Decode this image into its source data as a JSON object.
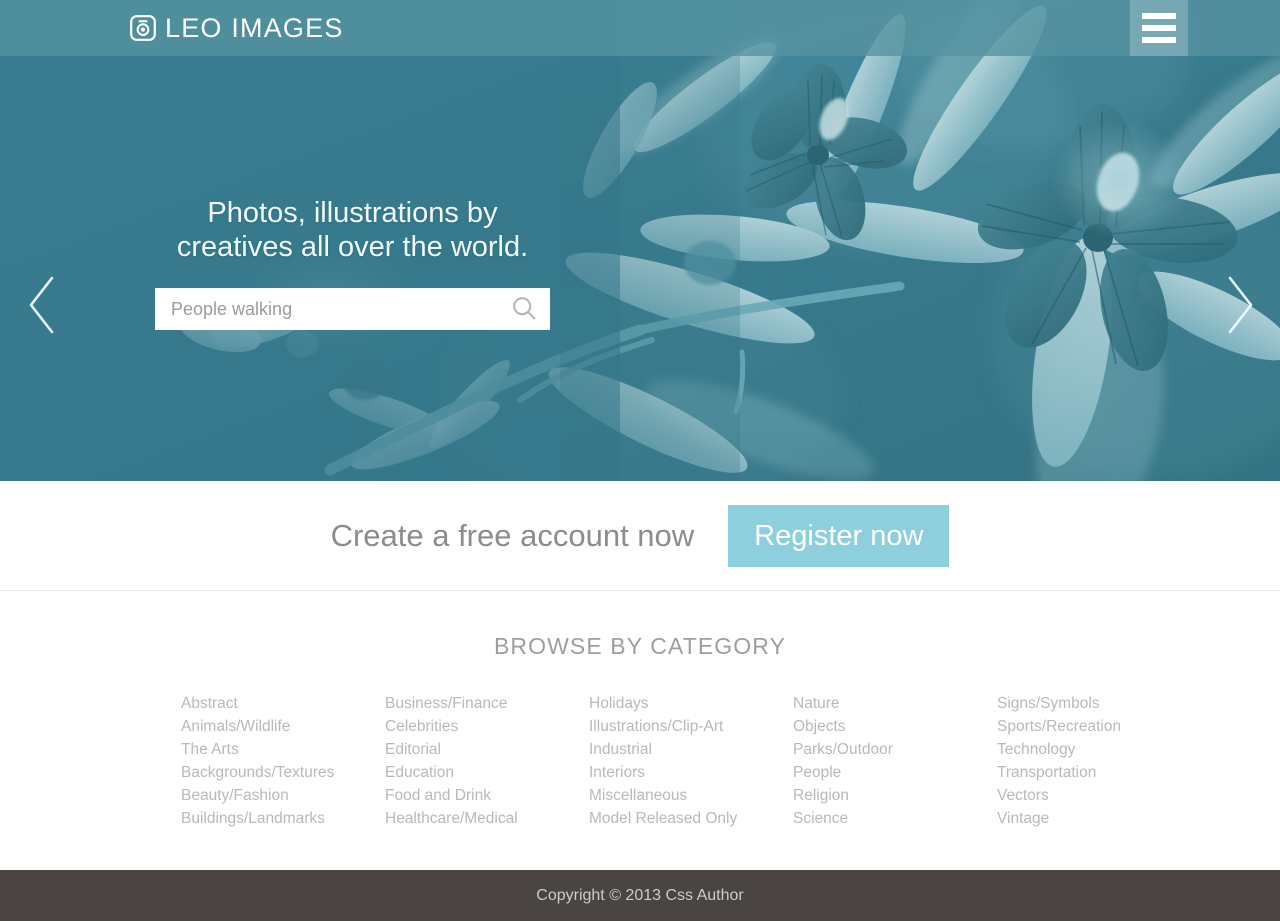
{
  "header": {
    "logo_icon": "camera-icon",
    "logo_text": "LEO IMAGES",
    "menu_icon": "hamburger-menu-icon"
  },
  "hero": {
    "headline": "Photos, illustrations by\ncreatives all over the world.",
    "headline_line1": "Photos, illustrations by",
    "headline_line2": "creatives all over the world.",
    "search": {
      "value": "People walking",
      "placeholder": "People walking",
      "button_icon": "search-icon"
    },
    "prev_icon": "chevron-left-icon",
    "next_icon": "chevron-right-icon",
    "background_alt": "teal-toned macro photograph of flowers"
  },
  "register": {
    "text": "Create a free account now",
    "button_label": "Register now",
    "button_color": "#8ecfdd"
  },
  "categories": {
    "title": "BROWSE BY CATEGORY",
    "columns": [
      [
        "Abstract",
        "Animals/Wildlife",
        "The Arts",
        "Backgrounds/Textures",
        "Beauty/Fashion",
        "Buildings/Landmarks"
      ],
      [
        "Business/Finance",
        "Celebrities",
        "Editorial",
        "Education",
        "Food and Drink",
        "Healthcare/Medical"
      ],
      [
        "Holidays",
        "Illustrations/Clip-Art",
        "Industrial",
        "Interiors",
        "Miscellaneous",
        "Model Released Only"
      ],
      [
        "Nature",
        "Objects",
        "Parks/Outdoor",
        "People",
        "Religion",
        "Science"
      ],
      [
        "Signs/Symbols",
        "Sports/Recreation",
        "Technology",
        "Transportation",
        "Vectors",
        "Vintage"
      ]
    ]
  },
  "footer": {
    "copyright": "Copyright © 2013 Css Author"
  },
  "colors": {
    "header_bar": "#5693a1",
    "hero_tint": "#3d7c8d",
    "accent": "#8ecfdd",
    "footer_bg": "#4a4442",
    "category_text": "#b9b9b9"
  }
}
